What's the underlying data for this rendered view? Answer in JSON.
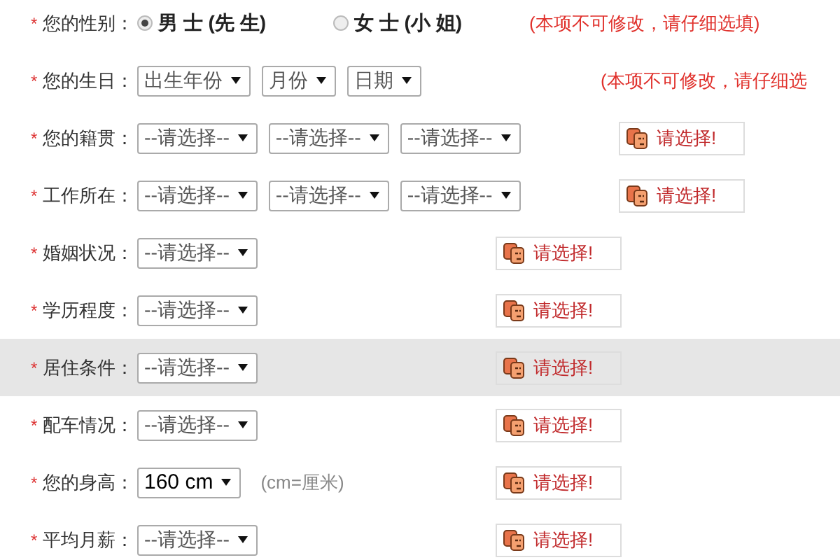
{
  "rows": [
    {
      "label": "您的性别：",
      "required_mark": "*",
      "highlighted": false,
      "radios": [
        {
          "label": "男 士 (先 生)",
          "selected": true
        },
        {
          "label": "女 士 (小 姐)",
          "selected": false
        }
      ],
      "note": "(本项不可修改，请仔细选填)"
    },
    {
      "label": "您的生日：",
      "required_mark": "*",
      "highlighted": false,
      "selects": [
        {
          "placeholder": "出生年份"
        },
        {
          "placeholder": "月份"
        },
        {
          "placeholder": "日期"
        }
      ],
      "note": "(本项不可修改，请仔细选"
    },
    {
      "label": "您的籍贯：",
      "required_mark": "*",
      "highlighted": false,
      "selects": [
        {
          "placeholder": "--请选择--"
        },
        {
          "placeholder": "--请选择--"
        },
        {
          "placeholder": "--请选择--"
        }
      ],
      "hint": "请选择!"
    },
    {
      "label": "工作所在：",
      "required_mark": "*",
      "highlighted": false,
      "selects": [
        {
          "placeholder": "--请选择--"
        },
        {
          "placeholder": "--请选择--"
        },
        {
          "placeholder": "--请选择--"
        }
      ],
      "hint": "请选择!"
    },
    {
      "label": "婚姻状况：",
      "required_mark": "*",
      "highlighted": false,
      "selects": [
        {
          "placeholder": "--请选择--"
        }
      ],
      "hint": "请选择!"
    },
    {
      "label": "学历程度：",
      "required_mark": "*",
      "highlighted": false,
      "selects": [
        {
          "placeholder": "--请选择--"
        }
      ],
      "hint": "请选择!"
    },
    {
      "label": "居住条件：",
      "required_mark": "*",
      "highlighted": true,
      "selects": [
        {
          "placeholder": "--请选择--"
        }
      ],
      "hint": "请选择!"
    },
    {
      "label": "配车情况：",
      "required_mark": "*",
      "highlighted": false,
      "selects": [
        {
          "placeholder": "--请选择--"
        }
      ],
      "hint": "请选择!"
    },
    {
      "label": "您的身高：",
      "required_mark": "*",
      "highlighted": false,
      "selects": [
        {
          "value": "160 cm"
        }
      ],
      "unit_note": "(cm=厘米)",
      "hint": "请选择!"
    },
    {
      "label": "平均月薪：",
      "required_mark": "*",
      "highlighted": false,
      "selects": [
        {
          "placeholder": "--请选择--"
        }
      ],
      "hint": "请选择!"
    }
  ]
}
